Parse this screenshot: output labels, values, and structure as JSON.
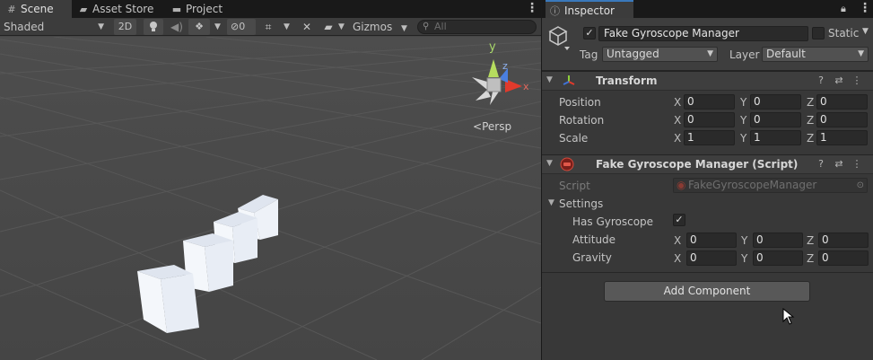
{
  "scene_tabs": [
    {
      "label": "Scene",
      "icon": "hash-grid-icon"
    },
    {
      "label": "Asset Store",
      "icon": "bag-icon"
    },
    {
      "label": "Project",
      "icon": "folder-icon"
    }
  ],
  "toolbar": {
    "shading_mode": "Shaded",
    "mode_2d": "2D",
    "hidden_count": "0",
    "gizmos": "Gizmos",
    "search_placeholder": "All"
  },
  "gizmo": {
    "axis_x": "x",
    "axis_y": "y",
    "axis_z": "z",
    "projection": "Persp",
    "colors": {
      "x": "#e03a2c",
      "y": "#8fcf3a",
      "z": "#3f73d8"
    }
  },
  "inspector": {
    "tab_label": "Inspector",
    "object_name": "Fake Gyroscope Manager",
    "active": true,
    "static_label": "Static",
    "tag_label": "Tag",
    "tag_value": "Untagged",
    "layer_label": "Layer",
    "layer_value": "Default"
  },
  "transform": {
    "title": "Transform",
    "rows": [
      {
        "label": "Position",
        "x": "0",
        "y": "0",
        "z": "0"
      },
      {
        "label": "Rotation",
        "x": "0",
        "y": "0",
        "z": "0"
      },
      {
        "label": "Scale",
        "x": "1",
        "y": "1",
        "z": "1"
      }
    ]
  },
  "script_component": {
    "title": "Fake Gyroscope Manager (Script)",
    "script_label": "Script",
    "script_value": "FakeGyroscopeManager",
    "settings_label": "Settings",
    "has_gyro_label": "Has Gyroscope",
    "has_gyro_checked": true,
    "rows": [
      {
        "label": "Attitude",
        "x": "0",
        "y": "0",
        "z": "0"
      },
      {
        "label": "Gravity",
        "x": "0",
        "y": "0",
        "z": "0"
      }
    ]
  },
  "axis_labels": {
    "x": "X",
    "y": "Y",
    "z": "Z"
  },
  "add_component_label": "Add Component"
}
